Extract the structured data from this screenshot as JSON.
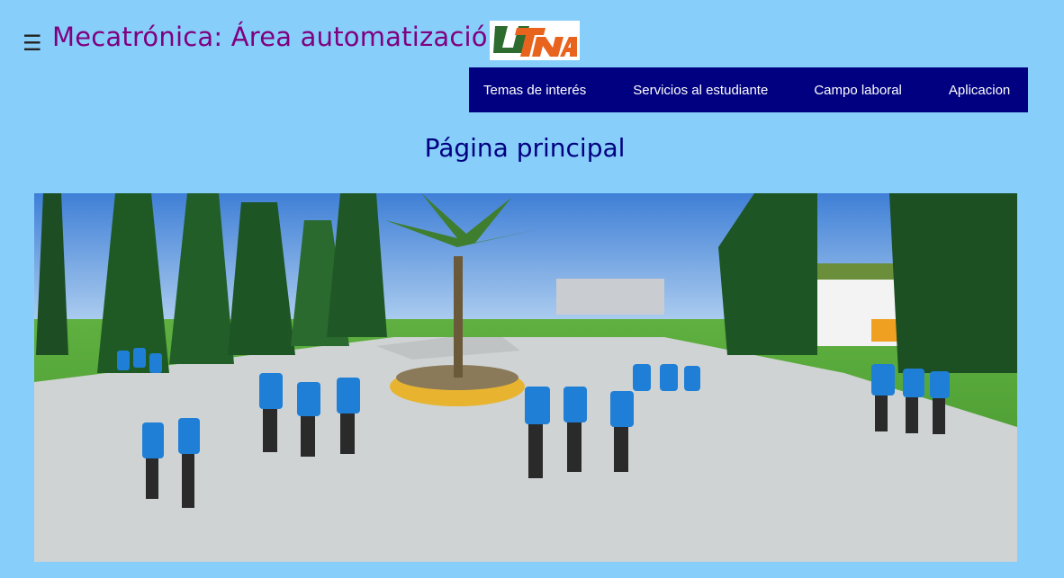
{
  "header": {
    "menu_icon": "hamburger-menu-icon",
    "menu_glyph": "☰",
    "title": "Mecatrónica: Área automatización",
    "logo_text": "UTNA"
  },
  "nav": {
    "items": [
      {
        "label": "Temas de interés"
      },
      {
        "label": "Servicios al estudiante"
      },
      {
        "label": "Campo laboral"
      },
      {
        "label": "Aplicacion"
      }
    ]
  },
  "main": {
    "heading": "Página principal",
    "hero_image": "campus-photo-students-walking"
  },
  "colors": {
    "background": "#87cefa",
    "title": "#800080",
    "nav_bg": "#000080",
    "nav_text": "#ffffff",
    "heading": "#000080"
  }
}
